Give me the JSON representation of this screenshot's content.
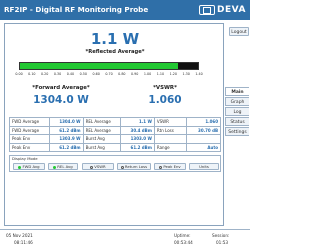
{
  "header": {
    "title": "RF2IP - Digital RF Monitoring Probe",
    "brand": "DEVA"
  },
  "sidebar": {
    "logout": "Logout",
    "items": [
      {
        "label": "Main",
        "active": true
      },
      {
        "label": "Graph",
        "active": false
      },
      {
        "label": "Log",
        "active": false
      },
      {
        "label": "Status",
        "active": false
      },
      {
        "label": "Settings",
        "active": false
      }
    ]
  },
  "main": {
    "reflected_value": "1.1 W",
    "reflected_label": "*Reflected Average*",
    "meter": {
      "fill_fraction": 0.89,
      "peak_fraction": 0.91,
      "ticks": [
        "0.00",
        "0.10",
        "0.20",
        "0.30",
        "0.40",
        "0.50",
        "0.60",
        "0.70",
        "0.80",
        "0.90",
        "1.00",
        "1.10",
        "1.20",
        "1.30",
        "1.40"
      ],
      "fill_color": "#22c832"
    },
    "forward_label": "*Forward Average*",
    "forward_value": "1304.0 W",
    "vswr_label": "*VSWR*",
    "vswr_value": "1.060"
  },
  "measurements": [
    [
      {
        "label": "FWD Average",
        "value": "1304.0 W"
      },
      {
        "label": "REL Average",
        "value": "1.1 W"
      },
      {
        "label": "VSWR",
        "value": "1.060"
      }
    ],
    [
      {
        "label": "FWD Average",
        "value": "61.2 dBm"
      },
      {
        "label": "REL Average",
        "value": "30.4 dBm"
      },
      {
        "label": "Rtn Loss",
        "value": "30.70 dB"
      }
    ],
    [
      {
        "label": "Peak Env",
        "value": "1303.9 W"
      },
      {
        "label": "Burst Avg",
        "value": "1303.0 W"
      },
      {
        "label": "",
        "value": ""
      }
    ],
    [
      {
        "label": "Peak Env",
        "value": "61.2 dBm"
      },
      {
        "label": "Burst Avg",
        "value": "61.2 dBm"
      },
      {
        "label": "Range",
        "value": "Auto"
      }
    ]
  ],
  "display_mode": {
    "title": "Display Mode",
    "buttons": [
      {
        "label": "FWD Avg",
        "on": true
      },
      {
        "label": "REL Avg",
        "on": true
      },
      {
        "label": "VSWR",
        "on": false
      },
      {
        "label": "Return Loss",
        "on": false
      },
      {
        "label": "Peak Env",
        "on": false
      },
      {
        "label": "Units",
        "on": false
      }
    ]
  },
  "status": {
    "date": "05 Nov 2021",
    "time": "08:11:46",
    "uptime_label": "Uptime:",
    "uptime_value": "00:53:44",
    "session_label": "Session:",
    "session_value": "01:53"
  }
}
